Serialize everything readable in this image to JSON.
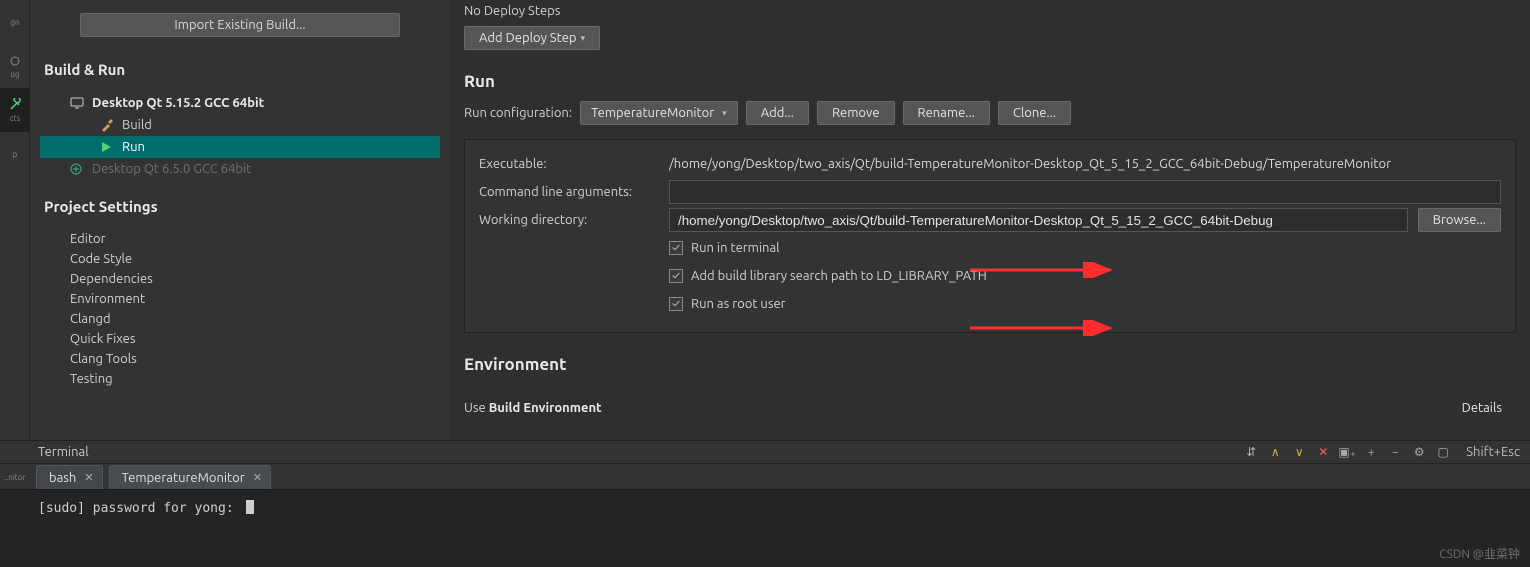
{
  "sidebar_icons": [
    {
      "name": "design-icon",
      "label": "gn"
    },
    {
      "name": "debug-icon",
      "label": "ug"
    },
    {
      "name": "projects-icon",
      "label": "cts"
    },
    {
      "name": "help-icon",
      "label": "p"
    }
  ],
  "import_button": "Import Existing Build...",
  "build_run": {
    "title": "Build & Run",
    "kits": [
      {
        "label": "Desktop Qt 5.15.2 GCC 64bit",
        "bold": true,
        "icon": "monitor-icon"
      },
      {
        "label": "Build",
        "icon": "hammer-icon",
        "indent": 2
      },
      {
        "label": "Run",
        "icon": "play-icon",
        "indent": 2,
        "selected": true
      },
      {
        "label": "Desktop Qt 6.5.0 GCC 64bit",
        "dim": true,
        "icon": "plus-circle-icon",
        "indent": 1
      }
    ]
  },
  "project_settings": {
    "title": "Project Settings",
    "items": [
      "Editor",
      "Code Style",
      "Dependencies",
      "Environment",
      "Clangd",
      "Quick Fixes",
      "Clang Tools",
      "Testing"
    ]
  },
  "deploy": {
    "no_steps": "No Deploy Steps",
    "add_step": "Add Deploy Step"
  },
  "run": {
    "title": "Run",
    "config_label": "Run configuration:",
    "config_value": "TemperatureMonitor",
    "buttons": {
      "add": "Add...",
      "remove": "Remove",
      "rename": "Rename...",
      "clone": "Clone..."
    },
    "exec_label": "Executable:",
    "exec_value": "/home/yong/Desktop/two_axis/Qt/build-TemperatureMonitor-Desktop_Qt_5_15_2_GCC_64bit-Debug/TemperatureMonitor",
    "args_label": "Command line arguments:",
    "args_value": "",
    "wd_label": "Working directory:",
    "wd_value": "/home/yong/Desktop/two_axis/Qt/build-TemperatureMonitor-Desktop_Qt_5_15_2_GCC_64bit-Debug",
    "browse": "Browse...",
    "cb_terminal": "Run in terminal",
    "cb_ldpath": "Add build library search path to LD_LIBRARY_PATH",
    "cb_root": "Run as root user"
  },
  "environment": {
    "title": "Environment",
    "use_prefix": "Use ",
    "use_bold": "Build Environment",
    "details": "Details"
  },
  "terminal": {
    "title": "Terminal",
    "shortcut": "Shift+Esc",
    "tabs": [
      {
        "label": "bash",
        "active": false
      },
      {
        "label": "TemperatureMonitor",
        "active": true
      }
    ],
    "prompt": "[sudo] password for yong:",
    "side_label": "..nitor"
  },
  "watermark": "CSDN @韭菜钟"
}
